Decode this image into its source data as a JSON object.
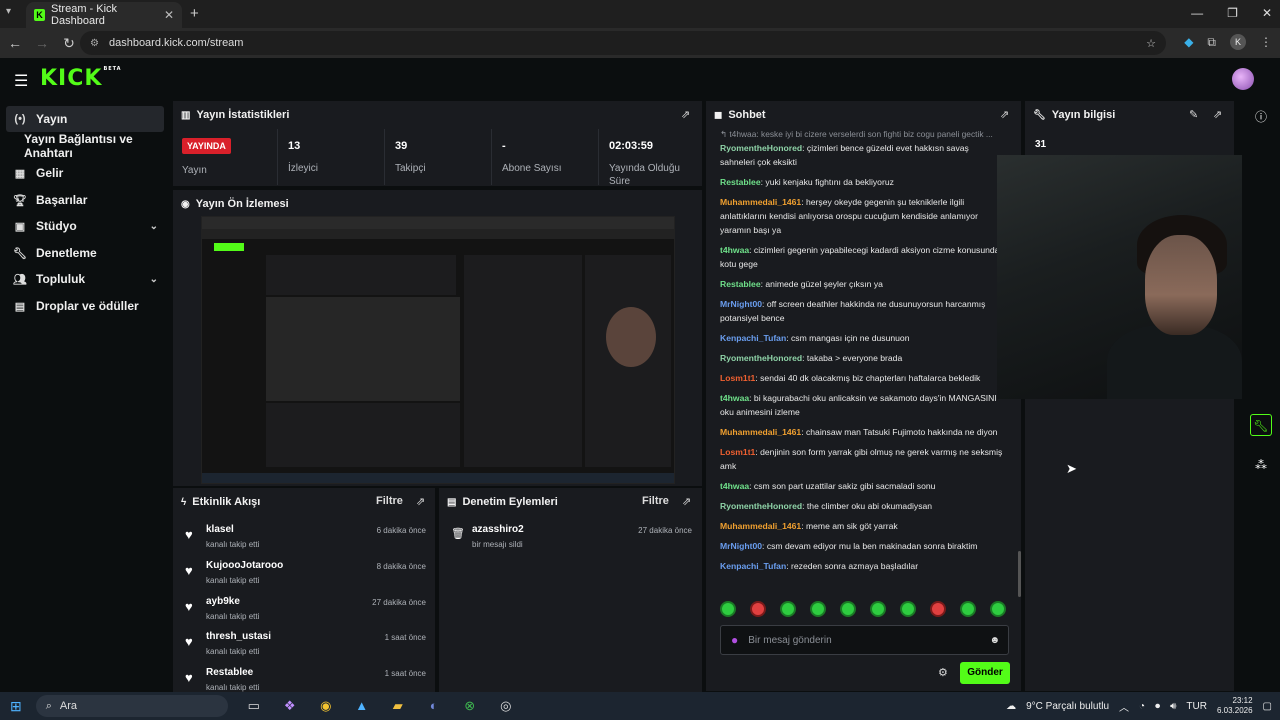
{
  "browser": {
    "tab_title": "Stream - Kick Dashboard",
    "url": "dashboard.kick.com/stream"
  },
  "kick": {
    "logo": "KICK",
    "logo_badge": "BETA"
  },
  "sidebar": {
    "items": [
      {
        "label": "Yayın",
        "icon": "broadcast-icon",
        "active": true
      },
      {
        "label": "Yayın Bağlantısı ve Anahtarı",
        "icon": ""
      },
      {
        "label": "Gelir",
        "icon": "chart-icon"
      },
      {
        "label": "Başarılar",
        "icon": "trophy-icon"
      },
      {
        "label": "Stüdyo",
        "icon": "studio-icon",
        "expandable": true
      },
      {
        "label": "Denetleme",
        "icon": "wrench-icon"
      },
      {
        "label": "Topluluk",
        "icon": "community-icon",
        "expandable": true
      },
      {
        "label": "Droplar ve ödüller",
        "icon": "gift-icon"
      }
    ]
  },
  "stats_panel": {
    "title": "Yayın İstatistikleri",
    "live_badge": "YAYINDA",
    "live_label": "Yayın",
    "stats": [
      {
        "value": "13",
        "label": "İzleyici"
      },
      {
        "value": "39",
        "label": "Takipçi"
      },
      {
        "value": "-",
        "label": "Abone Sayısı"
      },
      {
        "value": "02:03:59",
        "label": "Yayında Olduğu Süre"
      }
    ]
  },
  "preview_panel": {
    "title": "Yayın Ön İzlemesi"
  },
  "activity_panel": {
    "title": "Etkinlik Akışı",
    "filter": "Filtre",
    "items": [
      {
        "name": "klasel",
        "action": "kanalı takip etti",
        "time": "6 dakika önce"
      },
      {
        "name": "KujoooJotarooo",
        "action": "kanalı takip etti",
        "time": "8 dakika önce"
      },
      {
        "name": "ayb9ke",
        "action": "kanalı takip etti",
        "time": "27 dakika önce"
      },
      {
        "name": "thresh_ustasi",
        "action": "kanalı takip etti",
        "time": "1 saat önce"
      },
      {
        "name": "Restablee",
        "action": "kanalı takip etti",
        "time": "1 saat önce"
      }
    ]
  },
  "moderation_panel": {
    "title": "Denetim Eylemleri",
    "filter": "Filtre",
    "items": [
      {
        "name": "azasshiro2",
        "action": "bir mesajı sildi",
        "time": "27 dakika önce"
      }
    ]
  },
  "chat_panel": {
    "title": "Sohbet",
    "reply_preview": "t4hwaa: keske iyi bi cizere verselerdi son fighti biz cogu paneli gectik ...",
    "messages": [
      {
        "user": "RyomentheHonored",
        "color": "#8fd4a8",
        "text": "çizimleri bence güzeldi evet hakkısn savaş sahneleri çok eksikti"
      },
      {
        "user": "Restablee",
        "color": "#6fe08a",
        "text": "yuki kenjaku fightını da bekliyoruz"
      },
      {
        "user": "Muhammedali_1461",
        "color": "#f0a030",
        "text": "herşey okeyde gegenin şu tekniklerle ilgili anlattıklarını kendisi anlıyorsa orospu cucuğum kendiside anlamıyor yaramın başı ya"
      },
      {
        "user": "t4hwaa",
        "color": "#6fe08a",
        "text": "cizimleri gegenin yapabilecegi kadardi aksiyon cizme konusunda kotu gege"
      },
      {
        "user": "Restablee",
        "color": "#6fe08a",
        "text": "animede güzel şeyler çıksın ya"
      },
      {
        "user": "MrNight00",
        "color": "#6a9ef0",
        "text": "off screen deathler hakkinda ne dusunuyorsun harcanmış potansiyel bence"
      },
      {
        "user": "Kenpachi_Tufan",
        "color": "#6a9ef0",
        "text": "csm mangası için ne dusunuon"
      },
      {
        "user": "RyomentheHonored",
        "color": "#8fd4a8",
        "text": "takaba > everyone brada"
      },
      {
        "user": "Losm1t1",
        "color": "#f06030",
        "text": "sendai 40 dk olacakmış biz chapterları haftalarca bekledik"
      },
      {
        "user": "t4hwaa",
        "color": "#6fe08a",
        "text": "bi kagurabachi oku anlicaksin ve sakamoto days'in MANGASINI oku animesini izleme"
      },
      {
        "user": "Muhammedali_1461",
        "color": "#f0a030",
        "text": "chainsaw man Tatsuki Fujimoto hakkında ne diyon"
      },
      {
        "user": "Losm1t1",
        "color": "#f06030",
        "text": "denjinin son form yarrak gibi olmuş ne gerek varmış ne seksmiş amk"
      },
      {
        "user": "t4hwaa",
        "color": "#6fe08a",
        "text": "csm son part uzattilar sakiz gibi sacmaladi sonu"
      },
      {
        "user": "RyomentheHonored",
        "color": "#8fd4a8",
        "text": "the climber oku abi okumadiysan"
      },
      {
        "user": "Muhammedali_1461",
        "color": "#f0a030",
        "text": "meme am sik göt yarrak"
      },
      {
        "user": "MrNight00",
        "color": "#6a9ef0",
        "text": "csm devam ediyor mu la ben makinadan sonra biraktim"
      },
      {
        "user": "Kenpachi_Tufan",
        "color": "#6a9ef0",
        "text": "rezeden sonra azmaya başladılar"
      }
    ],
    "input_placeholder": "Bir mesaj gönderin",
    "send_label": "Gönder"
  },
  "info_panel": {
    "title": "Yayın bilgisi",
    "value": "31"
  },
  "taskbar": {
    "search_placeholder": "Ara",
    "weather": "9°C  Parçalı bulutlu",
    "lang": "TUR",
    "time": "23:12",
    "date": "6.03.2026"
  },
  "colors": {
    "accent": "#53fc18",
    "live": "#d9202a",
    "panel": "#191b1f"
  }
}
